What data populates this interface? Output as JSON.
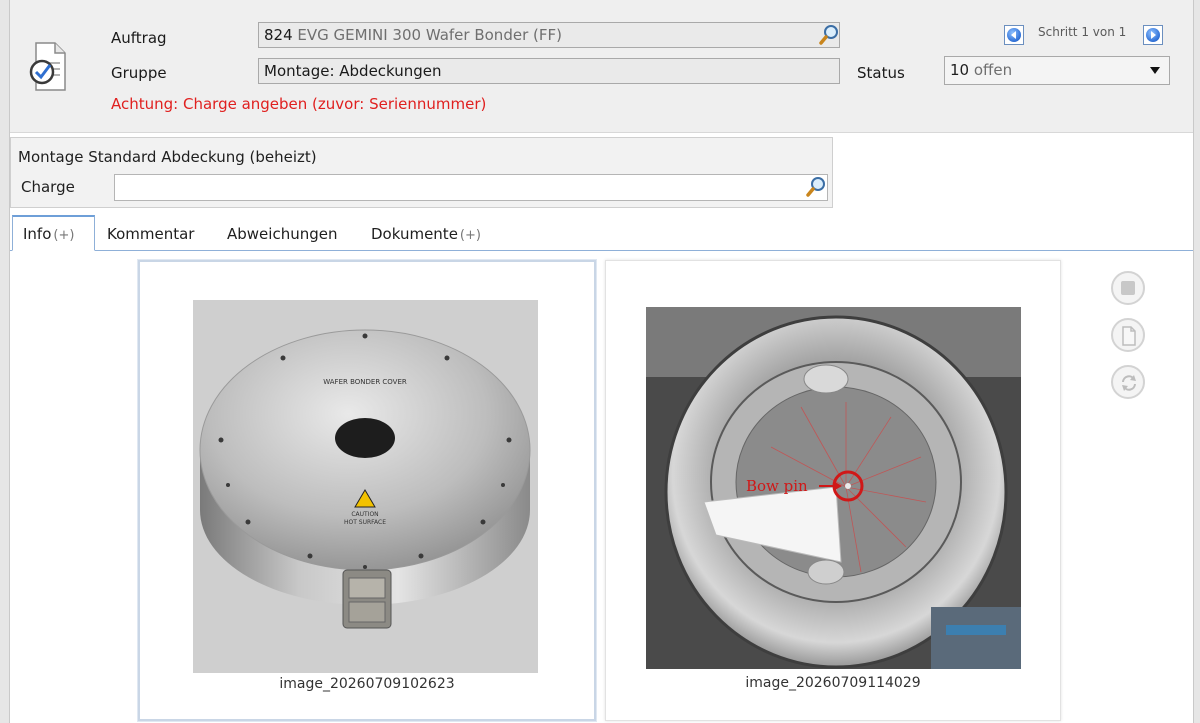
{
  "header": {
    "auftrag_label": "Auftrag",
    "auftrag_number": "824",
    "auftrag_name": "EVG GEMINI 300 Wafer Bonder (FF)",
    "gruppe_label": "Gruppe",
    "gruppe_value": "Montage: Abdeckungen",
    "warning": "Achtung: Charge angeben (zuvor: Seriennummer)",
    "status_label": "Status",
    "status_code": "10",
    "status_text": "offen",
    "step_text": "Schritt 1 von 1"
  },
  "charge_panel": {
    "title": "Montage Standard Abdeckung (beheizt)",
    "charge_label": "Charge",
    "charge_value": ""
  },
  "tabs": [
    {
      "label": "Info",
      "suffix": "(+)"
    },
    {
      "label": "Kommentar",
      "suffix": ""
    },
    {
      "label": "Abweichungen",
      "suffix": ""
    },
    {
      "label": "Dokumente",
      "suffix": "(+)"
    }
  ],
  "images": [
    {
      "caption": "image_20260709102623",
      "label_top": "WAFER BONDER COVER",
      "label_warn1": "CAUTION",
      "label_warn2": "HOT SURFACE"
    },
    {
      "caption": "image_20260709114029",
      "annotation": "Bow pin"
    }
  ],
  "colors": {
    "warning": "#e0201f",
    "tab_border": "#8fb0d8",
    "nav_blue": "#2e6fd6"
  },
  "icons": {
    "task": "task-check-icon",
    "search": "magnifier-icon",
    "prev": "arrow-left-icon",
    "next": "arrow-right-icon",
    "actions": [
      "stop-icon",
      "document-icon",
      "refresh-icon"
    ]
  }
}
